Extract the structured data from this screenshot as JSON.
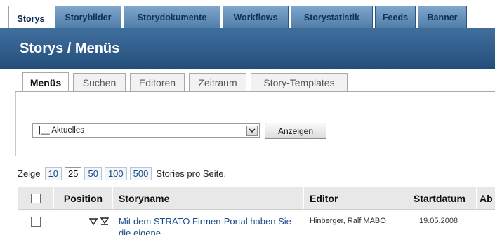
{
  "top_tabs": [
    {
      "label": "Storys",
      "active": true
    },
    {
      "label": "Storybilder"
    },
    {
      "label": "Storydokumente"
    },
    {
      "label": "Workflows"
    },
    {
      "label": "Storystatistik"
    },
    {
      "label": "Feeds"
    },
    {
      "label": "Banner"
    }
  ],
  "page_title": "Storys / Menüs",
  "sub_tabs": [
    {
      "label": "Menüs",
      "active": true
    },
    {
      "label": "Suchen"
    },
    {
      "label": "Editoren"
    },
    {
      "label": "Zeitraum"
    },
    {
      "label": "Story-Templates"
    }
  ],
  "menu_select": {
    "value": "|__ Aktuelles"
  },
  "show_button": "Anzeigen",
  "paging": {
    "prefix": "Zeige",
    "options": [
      "10",
      "25",
      "50",
      "100",
      "500"
    ],
    "selected": "25",
    "suffix": "Stories pro Seite."
  },
  "table": {
    "headers": {
      "position": "Position",
      "storyname": "Storyname",
      "editor": "Editor",
      "startdatum": "Startdatum",
      "next": "Ab"
    },
    "rows": [
      {
        "storyname": "Mit dem STRATO Firmen-Portal haben Sie die eigene",
        "editor": "Hinberger, Ralf MABO",
        "startdatum": "19.05.2008"
      }
    ]
  },
  "colors": {
    "accent": "#2d5a88",
    "tab_blue": "#5f89b3",
    "link": "#1a4c88"
  }
}
